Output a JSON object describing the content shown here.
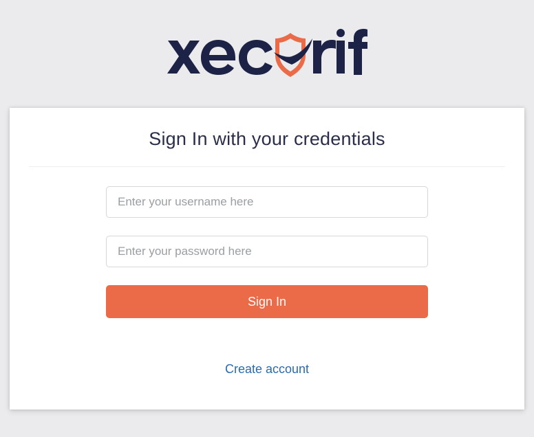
{
  "brand": {
    "name": "xecurify",
    "colors": {
      "text": "#1d2347",
      "accent": "#eb6a47"
    }
  },
  "card": {
    "title": "Sign In with your credentials"
  },
  "form": {
    "username": {
      "placeholder": "Enter your username here",
      "value": ""
    },
    "password": {
      "placeholder": "Enter your password here",
      "value": ""
    },
    "submit_label": "Sign In"
  },
  "links": {
    "create_account": "Create account"
  }
}
